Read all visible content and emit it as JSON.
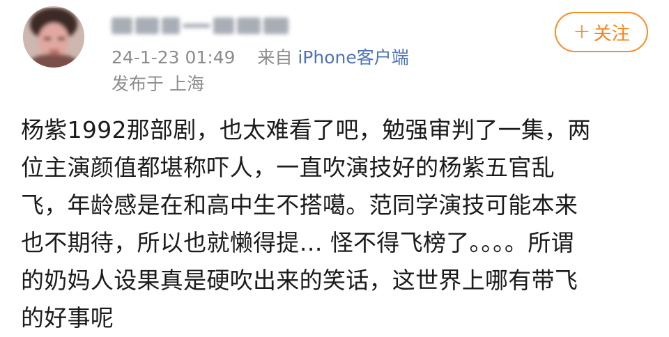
{
  "post": {
    "author": {
      "avatar_icon": "user-avatar",
      "name_blurred": true
    },
    "timestamp": "24-1-23 01:49",
    "source_prefix": "来自",
    "source_name": "iPhone客户端",
    "location": "发布于 上海",
    "follow_label": "关注",
    "body_lines": [
      "杨紫1992那部剧，也太难看了吧，勉强审判了一集，两",
      "位主演颜值都堪称吓人，一直吹演技好的杨紫五官乱",
      "飞，年龄感是在和高中生不搭噶。范同学演技可能本来",
      "也不期待，所以也就懒得提… 怪不得飞榜了。。。。所谓",
      "的奶妈人设果真是硬吹出来的笑话，这世界上哪有带飞",
      "的好事呢"
    ]
  },
  "colors": {
    "accent_orange": "#ff7f10",
    "link_blue": "#4f72b8",
    "meta_gray": "#8c8c8c",
    "text": "#1b1b1b"
  }
}
